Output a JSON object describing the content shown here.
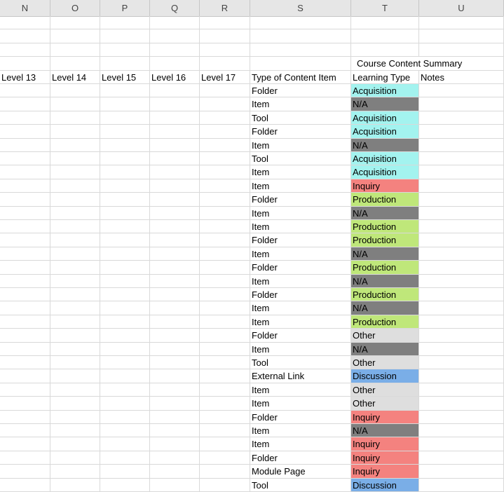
{
  "columns": [
    "N",
    "O",
    "P",
    "Q",
    "R",
    "S",
    "T",
    "U"
  ],
  "summary_title": "Course Content Summary",
  "headers": {
    "N": "Level 13",
    "O": "Level 14",
    "P": "Level 15",
    "Q": "Level 16",
    "R": "Level 17",
    "S": "Type of Content Item",
    "T": "Learning Type",
    "U": "Notes"
  },
  "learning_type_colors": {
    "Acquisition": "#a3f3ef",
    "N/A": "#7f7f7f",
    "Inquiry": "#f4827f",
    "Production": "#bfe77a",
    "Other": "#dedede",
    "Discussion": "#7aaee7"
  },
  "rows": [
    {
      "type": "Folder",
      "learning": "Acquisition"
    },
    {
      "type": "Item",
      "learning": "N/A"
    },
    {
      "type": "Tool",
      "learning": "Acquisition"
    },
    {
      "type": "Folder",
      "learning": "Acquisition"
    },
    {
      "type": "Item",
      "learning": "N/A"
    },
    {
      "type": "Tool",
      "learning": "Acquisition"
    },
    {
      "type": "Item",
      "learning": "Acquisition"
    },
    {
      "type": "Item",
      "learning": "Inquiry"
    },
    {
      "type": "Folder",
      "learning": "Production"
    },
    {
      "type": "Item",
      "learning": "N/A"
    },
    {
      "type": "Item",
      "learning": "Production"
    },
    {
      "type": "Folder",
      "learning": "Production"
    },
    {
      "type": "Item",
      "learning": "N/A"
    },
    {
      "type": "Folder",
      "learning": "Production"
    },
    {
      "type": "Item",
      "learning": "N/A"
    },
    {
      "type": "Folder",
      "learning": "Production"
    },
    {
      "type": "Item",
      "learning": "N/A"
    },
    {
      "type": "Item",
      "learning": "Production"
    },
    {
      "type": "Folder",
      "learning": "Other"
    },
    {
      "type": "Item",
      "learning": "N/A"
    },
    {
      "type": "Tool",
      "learning": "Other"
    },
    {
      "type": "External Link",
      "learning": "Discussion"
    },
    {
      "type": "Item",
      "learning": "Other"
    },
    {
      "type": "Item",
      "learning": "Other"
    },
    {
      "type": "Folder",
      "learning": "Inquiry"
    },
    {
      "type": "Item",
      "learning": "N/A"
    },
    {
      "type": "Item",
      "learning": "Inquiry"
    },
    {
      "type": "Folder",
      "learning": "Inquiry"
    },
    {
      "type": "Module Page",
      "learning": "Inquiry"
    },
    {
      "type": "Tool",
      "learning": "Discussion"
    }
  ]
}
